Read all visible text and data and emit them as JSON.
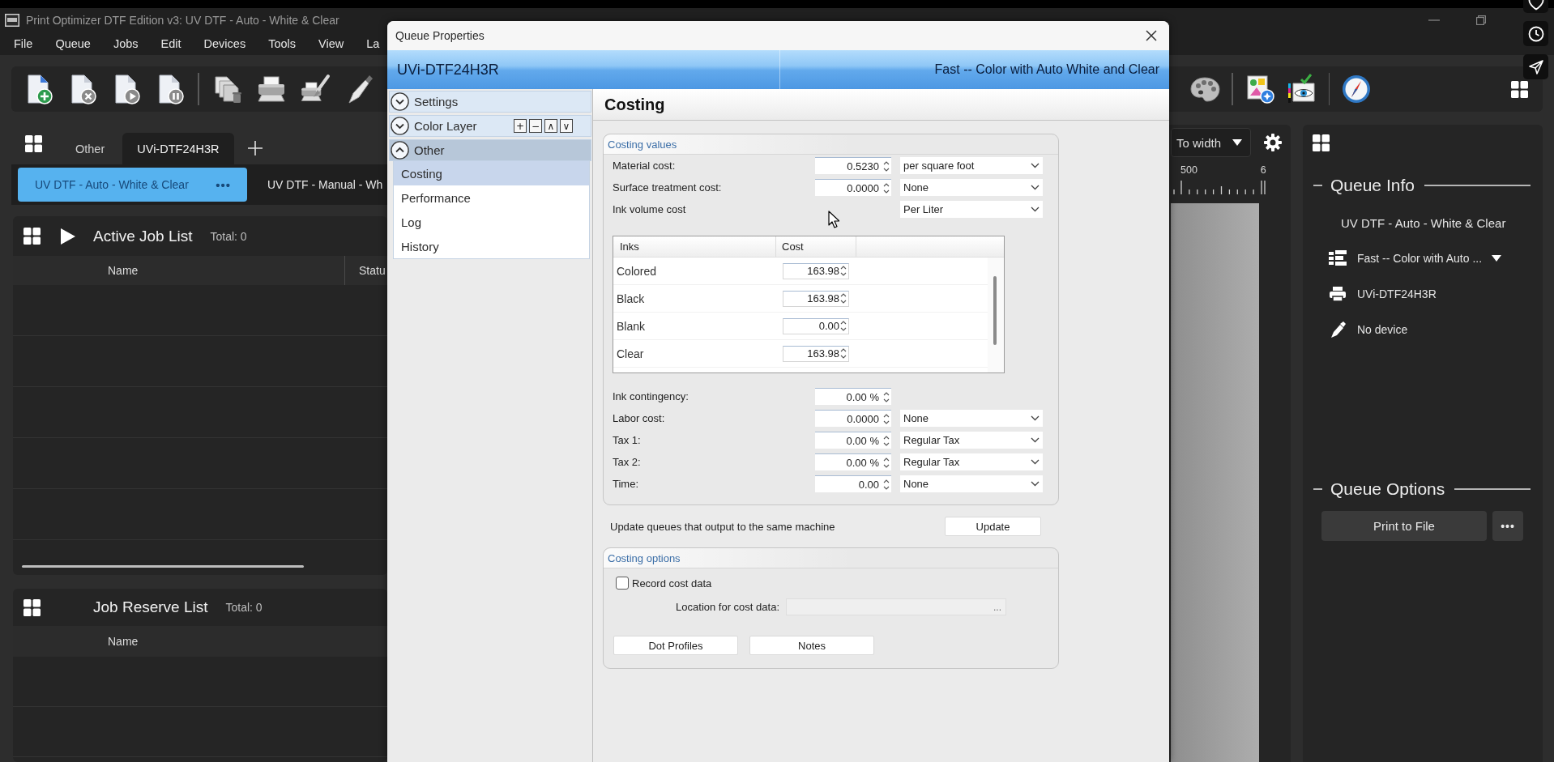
{
  "app": {
    "title": "Print Optimizer DTF Edition v3: UV DTF - Auto - White & Clear"
  },
  "menu": [
    "File",
    "Queue",
    "Jobs",
    "Edit",
    "Devices",
    "Tools",
    "View",
    "La"
  ],
  "printer_tabs": [
    {
      "label": "Other",
      "selected": false
    },
    {
      "label": "UVi-DTF24H3R",
      "selected": true
    }
  ],
  "queue_tabs": [
    {
      "label": "UV DTF - Auto - White & Clear",
      "selected": true,
      "more": "•••"
    },
    {
      "label": "UV DTF - Manual - Wh",
      "selected": false
    }
  ],
  "job_lists": [
    {
      "kind": "active",
      "title": "Active Job List",
      "total": "Total: 0",
      "columns": [
        "Name",
        "Statu"
      ]
    },
    {
      "kind": "reserve",
      "title": "Job Reserve List",
      "total": "Total: 0",
      "columns": [
        "Name"
      ]
    }
  ],
  "layout_panel": {
    "fit": "To width",
    "ruler_labels": [
      "500",
      "6"
    ]
  },
  "queue_info": {
    "title": "Queue Info",
    "queue_name": "UV DTF - Auto - White & Clear",
    "items": [
      {
        "kind": "mode",
        "text": "Fast -- Color with Auto ..."
      },
      {
        "kind": "printer",
        "text": "UVi-DTF24H3R"
      },
      {
        "kind": "device",
        "text": "No device"
      }
    ]
  },
  "queue_options": {
    "title": "Queue Options",
    "button": "Print to File",
    "more": "•••"
  },
  "dialog": {
    "title": "Queue Properties",
    "printer": "UVi-DTF24H3R",
    "mode": "Fast -- Color with Auto White and Clear",
    "nav": [
      {
        "label": "Settings",
        "expanded": false
      },
      {
        "label": "Color Layer",
        "expanded": false,
        "tools": [
          "+",
          "−",
          "∧",
          "∨"
        ]
      },
      {
        "label": "Other",
        "expanded": true,
        "children": [
          {
            "label": "Costing",
            "selected": true
          },
          {
            "label": "Performance",
            "selected": false
          },
          {
            "label": "Log",
            "selected": false
          },
          {
            "label": "History",
            "selected": false
          }
        ]
      }
    ],
    "page_title": "Costing",
    "costing_values": {
      "title": "Costing values",
      "fields": [
        {
          "kind": "spin_select",
          "label": "Material cost:",
          "value": "0.5230",
          "unit": "per square foot"
        },
        {
          "kind": "spin_select",
          "label": "Surface treatment cost:",
          "value": "0.0000",
          "unit": "None"
        },
        {
          "kind": "select",
          "label": "Ink volume cost",
          "unit": "Per Liter"
        }
      ],
      "inks": {
        "columns": [
          "Inks",
          "Cost"
        ],
        "rows": [
          {
            "name": "Colored",
            "cost": "163.98"
          },
          {
            "name": "Black",
            "cost": "163.98"
          },
          {
            "name": "Blank",
            "cost": "0.00"
          },
          {
            "name": "Clear",
            "cost": "163.98"
          }
        ]
      },
      "more_fields": [
        {
          "kind": "spin",
          "label": "Ink contingency:",
          "value": "0.00 %"
        },
        {
          "kind": "spin_select",
          "label": "Labor cost:",
          "value": "0.0000",
          "unit": "None"
        },
        {
          "kind": "spin_select",
          "label": "Tax 1:",
          "value": "0.00 %",
          "unit": "Regular Tax"
        },
        {
          "kind": "spin_select",
          "label": "Tax 2:",
          "value": "0.00 %",
          "unit": "Regular Tax"
        },
        {
          "kind": "spin_select",
          "label": "Time:",
          "value": "0.00",
          "unit": "None"
        }
      ]
    },
    "update": {
      "text": "Update queues that output to the same machine",
      "button": "Update"
    },
    "costing_options": {
      "title": "Costing options",
      "record": {
        "label": "Record cost data",
        "checked": false
      },
      "location_label": "Location for cost data:",
      "browse": "...",
      "buttons": [
        "Dot Profiles",
        "Notes"
      ]
    }
  }
}
